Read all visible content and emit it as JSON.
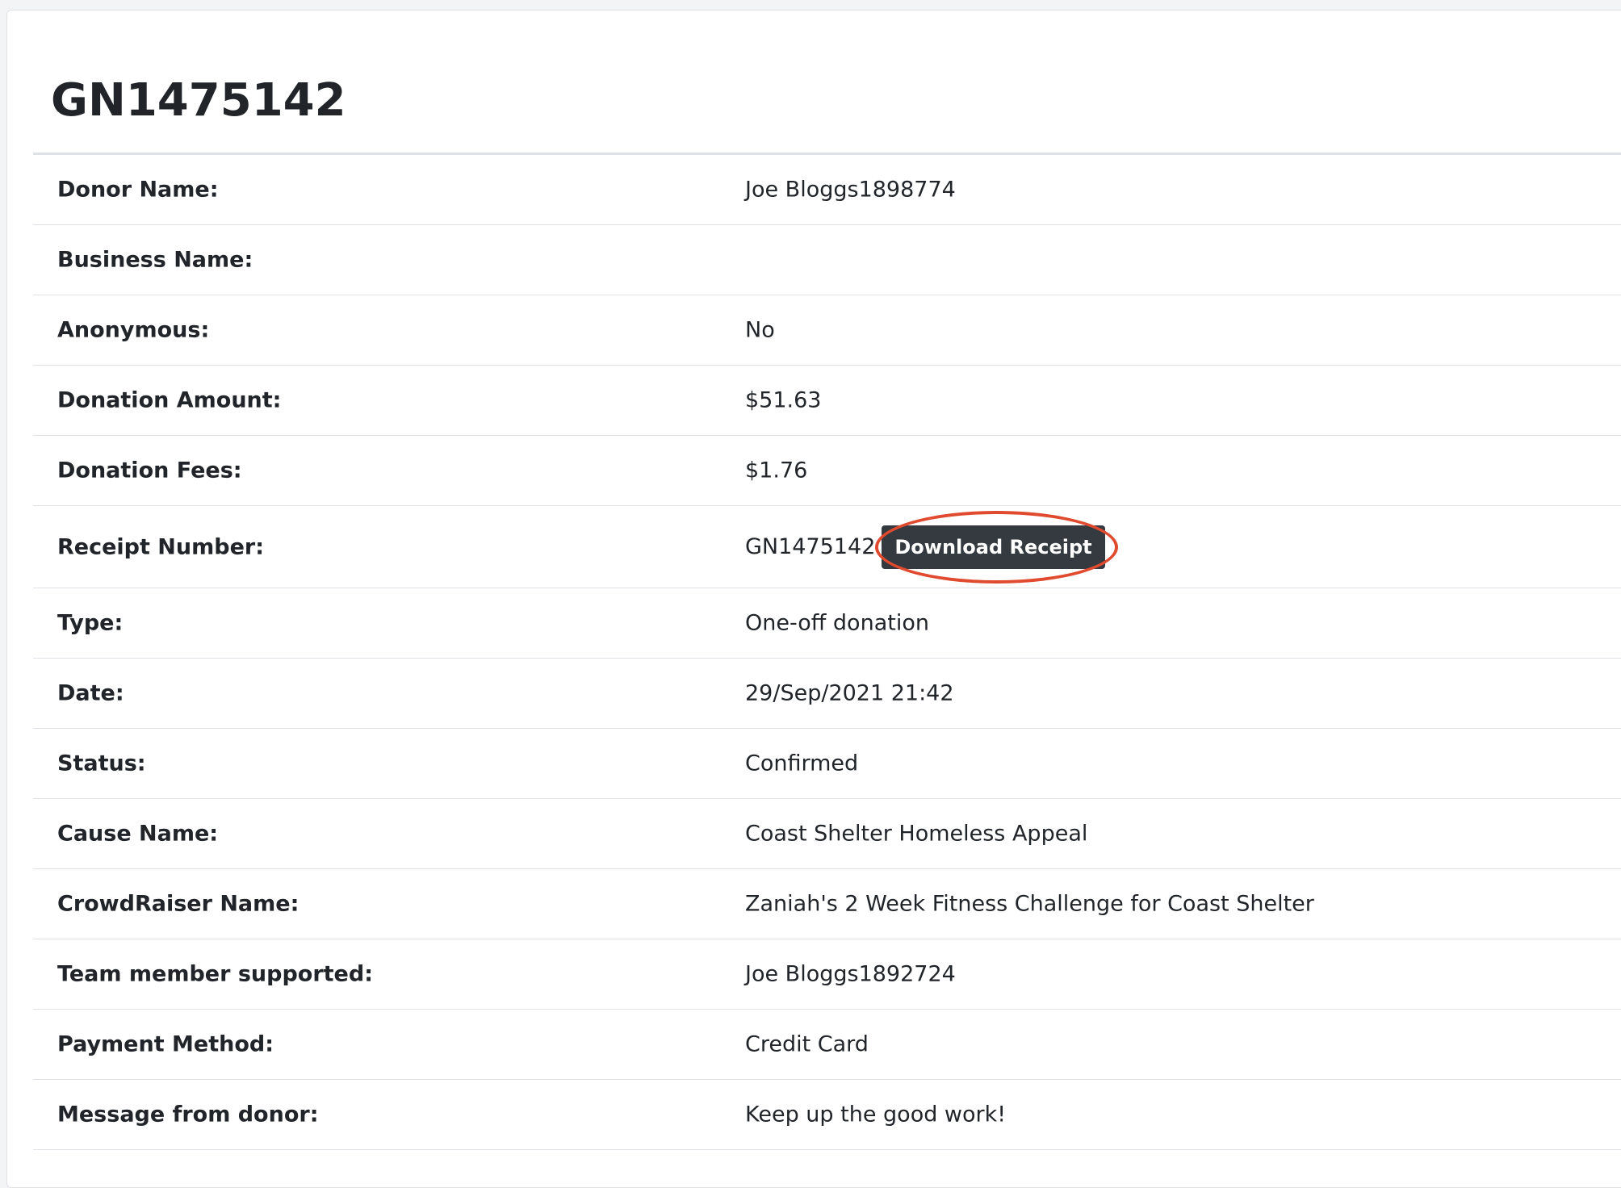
{
  "donation": {
    "title": "GN1475142",
    "fields": [
      {
        "label": "Donor Name:",
        "value": "Joe Bloggs1898774"
      },
      {
        "label": "Business Name:",
        "value": ""
      },
      {
        "label": "Anonymous:",
        "value": "No"
      },
      {
        "label": "Donation Amount:",
        "value": "$51.63"
      },
      {
        "label": "Donation Fees:",
        "value": "$1.76"
      },
      {
        "label": "Receipt Number:",
        "value": "GN1475142",
        "button": "Download Receipt"
      },
      {
        "label": "Type:",
        "value": "One-off donation"
      },
      {
        "label": "Date:",
        "value": "29/Sep/2021 21:42"
      },
      {
        "label": "Status:",
        "value": "Confirmed"
      },
      {
        "label": "Cause Name:",
        "value": "Coast Shelter Homeless Appeal"
      },
      {
        "label": "CrowdRaiser Name:",
        "value": "Zaniah's 2 Week Fitness Challenge for Coast Shelter"
      },
      {
        "label": "Team member supported:",
        "value": "Joe Bloggs1892724"
      },
      {
        "label": "Payment Method:",
        "value": "Credit Card"
      },
      {
        "label": "Message from donor:",
        "value": "Keep up the good work!"
      }
    ]
  },
  "colors": {
    "highlight": "#e04a2f",
    "button_bg": "#343a40"
  }
}
